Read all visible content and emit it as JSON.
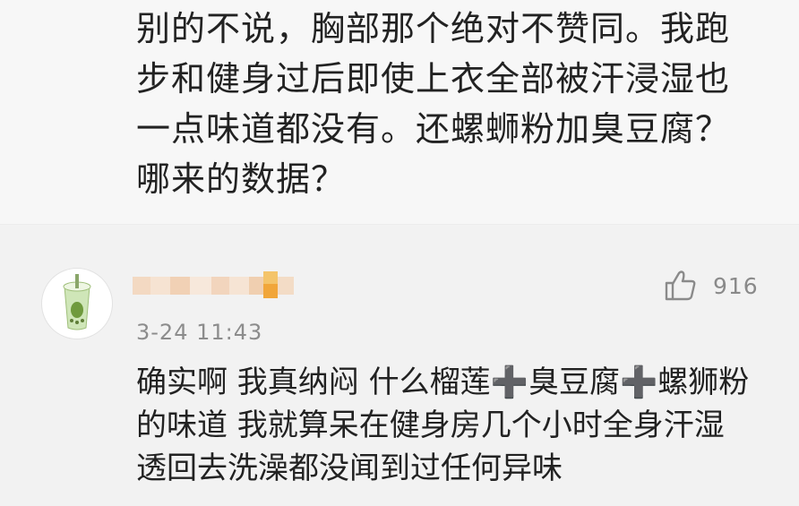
{
  "quoted_post": {
    "lines": [
      "别的不说，胸部那个绝对不赞同。我跑",
      "步和健身过后即使上衣全部被汗浸湿也",
      "一点味道都没有。还螺蛳粉加臭豆腐？",
      "哪来的数据？"
    ]
  },
  "comment": {
    "timestamp": "3-24 11:43",
    "like_count": "916",
    "lines": [
      "确实啊 我真纳闷 什么榴莲➕臭豆腐➕螺狮粉",
      "的味道 我就算呆在健身房几个小时全身汗湿",
      "透回去洗澡都没闻到过任何异味"
    ]
  },
  "colors": {
    "text": "#222222",
    "meta": "#8c8c8c",
    "background": "#f2f2f2"
  }
}
